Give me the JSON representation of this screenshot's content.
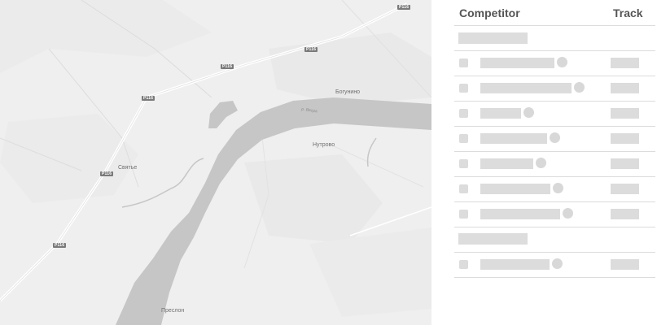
{
  "map": {
    "road_labels": [
      "P116",
      "P116",
      "P116",
      "P116",
      "P116",
      "P116"
    ],
    "place_labels": {
      "bogunino": "Богунино",
      "nutrovo": "Нутрово",
      "svyatye": "Святье",
      "preslon": "Преслон"
    },
    "river_label": "р. Весра",
    "colors": {
      "land": "#efefef",
      "water": "#c5c5c5",
      "road": "#ffffff"
    }
  },
  "panel": {
    "header": {
      "competitor_label": "Competitor",
      "track_label": "Track"
    },
    "groups": [
      {
        "rows": [
          {
            "status": "placeholder"
          },
          {
            "status": "placeholder"
          },
          {
            "status": "placeholder"
          },
          {
            "status": "placeholder"
          },
          {
            "status": "placeholder"
          },
          {
            "status": "placeholder"
          },
          {
            "status": "placeholder"
          }
        ]
      },
      {
        "rows": [
          {
            "status": "placeholder"
          }
        ]
      }
    ],
    "colors": {
      "header_text": "#555555",
      "skeleton": "#dcdcdc",
      "divider": "#dcdcdc"
    }
  }
}
